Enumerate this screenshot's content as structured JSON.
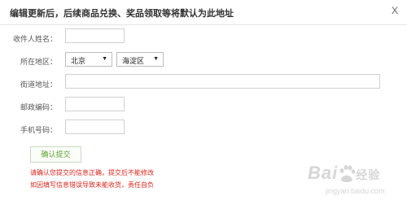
{
  "header": {
    "title": "编辑更新后，后续商品兑换、奖品领取等将默认为此地址",
    "close_label": "X"
  },
  "form": {
    "name_label": "收件人姓名：",
    "region_label": "所在地区：",
    "province_value": "北京",
    "district_value": "海淀区",
    "street_label": "街道地址：",
    "postal_label": "邮政编码：",
    "phone_label": "手机号码："
  },
  "actions": {
    "confirm_label": "确认提交"
  },
  "notes": {
    "line1": "请确认您提交的信息正确，提交后不能修改",
    "line2": "如因填写信息错误导致未能收货，责任自负"
  },
  "watermark": {
    "brand": "Bai",
    "brand_suffix": "经验",
    "url": "jingyan.baidu.com"
  },
  "colors": {
    "note_red": "#d9261c",
    "button_green": "#5aa130"
  }
}
